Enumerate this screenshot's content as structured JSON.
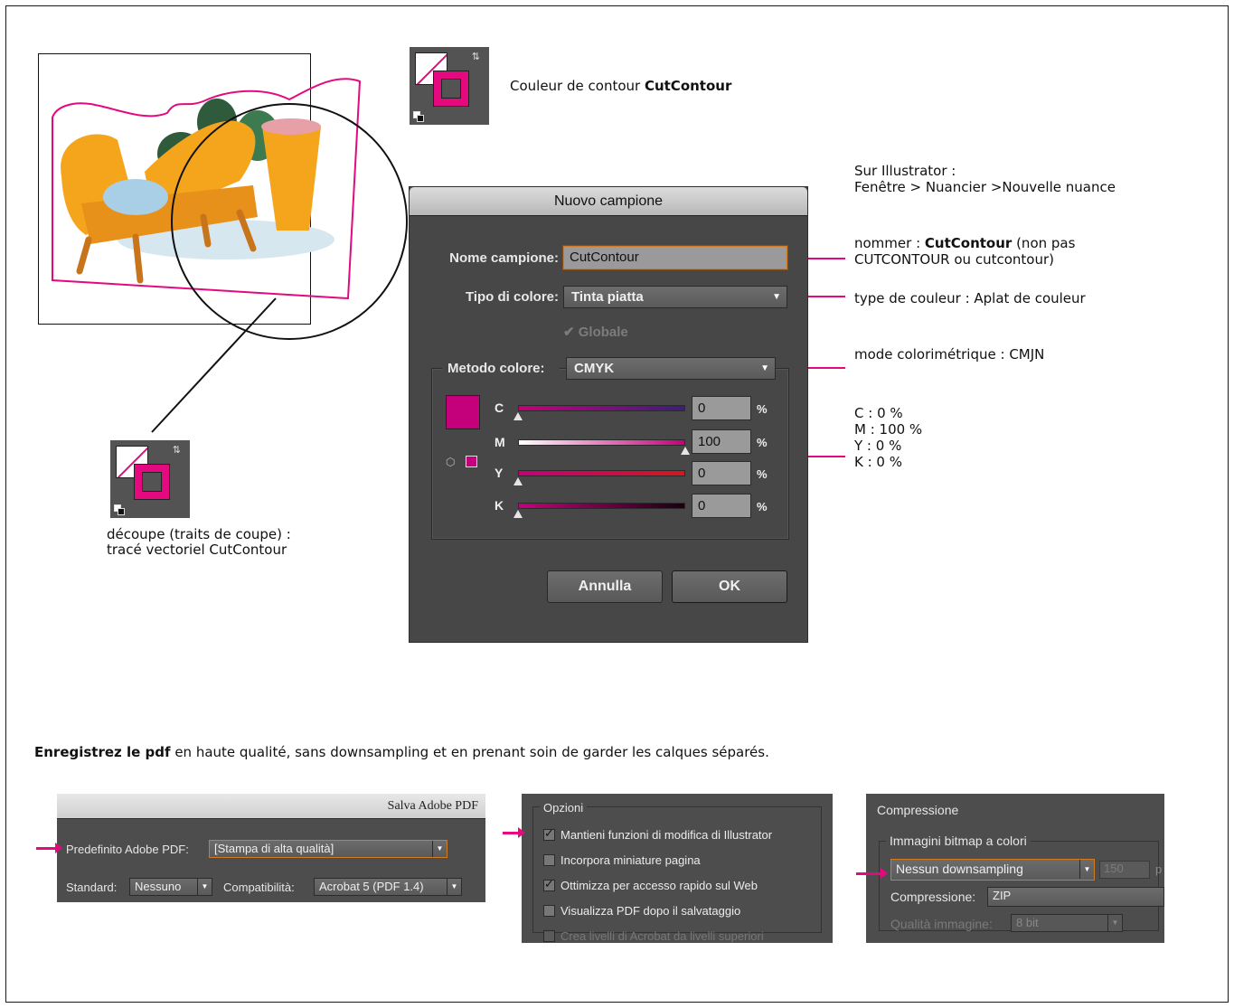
{
  "notes": {
    "stroke_label_prefix": "Couleur de contour ",
    "stroke_label_bold": "CutContour",
    "illustrator_line1": "Sur Illustrator :",
    "illustrator_line2": "Fenêtre > Nuancier >Nouvelle nuance",
    "name_prefix": "nommer : ",
    "name_bold": "CutContour",
    "name_suffix": " (non pas",
    "name_line2": "CUTCONTOUR ou cutcontour)",
    "color_type": "type de couleur : Aplat de couleur",
    "color_mode": "mode colorimétrique : CMJN",
    "cmyk_c": "C : 0 %",
    "cmyk_m": "M : 100 %",
    "cmyk_y": "Y : 0 %",
    "cmyk_k": "K : 0 %",
    "cut_line1": "découpe (traits de coupe) :",
    "cut_line2": "tracé vectoriel CutContour",
    "pdf_bold": "Enregistrez le pdf",
    "pdf_rest": " en haute qualité, sans downsampling et en prenant soin de garder les calques séparés."
  },
  "dialog": {
    "title": "Nuovo campione",
    "name_label": "Nome campione:",
    "name_value": "CutContour",
    "type_label": "Tipo di colore:",
    "type_value": "Tinta piatta",
    "global_label": "Globale",
    "method_label": "Metodo colore:",
    "method_value": "CMYK",
    "sliders": [
      {
        "letter": "C",
        "value": "0",
        "level": 0
      },
      {
        "letter": "M",
        "value": "100",
        "level": 100
      },
      {
        "letter": "Y",
        "value": "0",
        "level": 0
      },
      {
        "letter": "K",
        "value": "0",
        "level": 0
      }
    ],
    "percent": "%",
    "cancel": "Annulla",
    "ok": "OK"
  },
  "pdf_panel": {
    "title": "Salva Adobe PDF",
    "preset_label": "Predefinito Adobe PDF:",
    "preset_value": "[Stampa di alta qualità]",
    "standard_label": "Standard:",
    "standard_value": "Nessuno",
    "compat_label": "Compatibilità:",
    "compat_value": "Acrobat 5 (PDF 1.4)"
  },
  "options_panel": {
    "title": "Opzioni",
    "items": [
      {
        "label": "Mantieni funzioni di modifica di Illustrator",
        "checked": true
      },
      {
        "label": "Incorpora miniature pagina",
        "checked": false
      },
      {
        "label": "Ottimizza per accesso rapido sul Web",
        "checked": true
      },
      {
        "label": "Visualizza PDF dopo il salvataggio",
        "checked": false
      },
      {
        "label": "Crea livelli di Acrobat da livelli superiori",
        "checked": false
      }
    ]
  },
  "compression_panel": {
    "title": "Compressione",
    "group": "Immagini bitmap a colori",
    "downsampling_value": "Nessun downsampling",
    "ppi_value": "150",
    "ppi_unit": "p",
    "compression_label": "Compressione:",
    "compression_value": "ZIP",
    "quality_label": "Qualità immagine:",
    "quality_value": "8 bit"
  },
  "colors": {
    "cutcontour": "#e5097f",
    "swatch_preview": "#c4007a"
  }
}
